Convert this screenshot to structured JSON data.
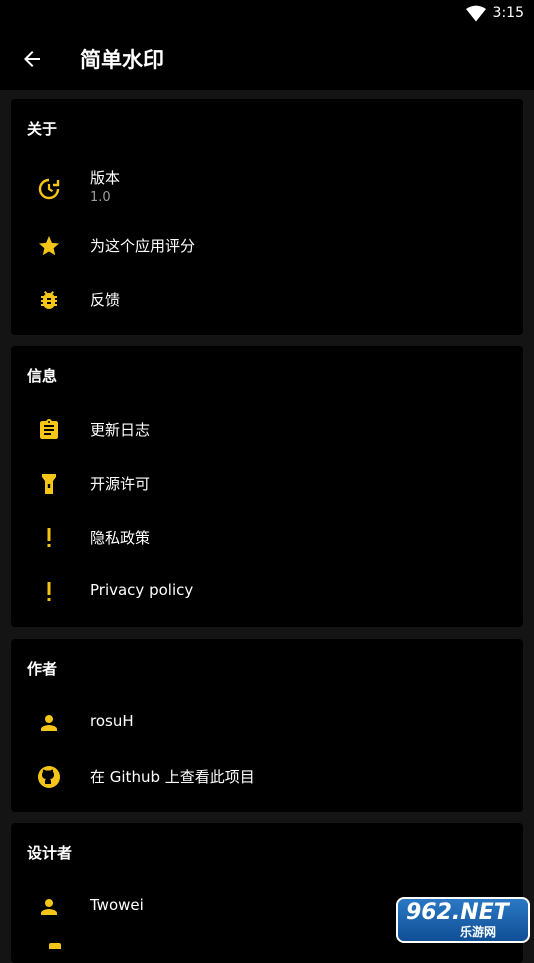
{
  "status_bar": {
    "time": "3:15"
  },
  "app_bar": {
    "title": "简单水印"
  },
  "sections": {
    "about": {
      "title": "关于",
      "version_label": "版本",
      "version_value": "1.0",
      "rate_label": "为这个应用评分",
      "feedback_label": "反馈"
    },
    "info": {
      "title": "信息",
      "changelog_label": "更新日志",
      "licenses_label": "开源许可",
      "privacy_cn_label": "隐私政策",
      "privacy_en_label": "Privacy policy"
    },
    "author": {
      "title": "作者",
      "name_label": "rosuH",
      "github_label": "在 Github 上查看此项目"
    },
    "designer": {
      "title": "设计者",
      "name_label": "Twowei"
    }
  },
  "watermark": {
    "text_top": "962.NET",
    "text_bottom": "乐游网"
  },
  "colors": {
    "accent": "#f5c518",
    "background": "#141414",
    "card": "#000000",
    "secondary_text": "#9e9e9e"
  }
}
